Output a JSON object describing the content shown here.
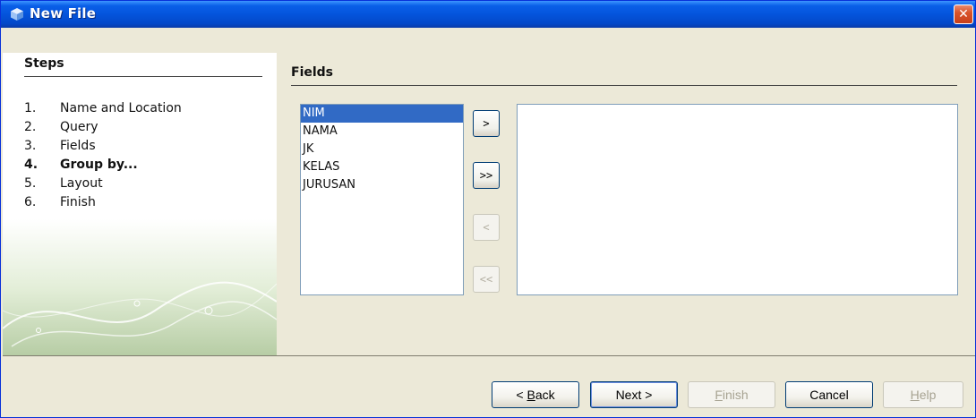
{
  "window": {
    "title": "New File",
    "close_symbol": "✕"
  },
  "steps": {
    "heading": "Steps",
    "items": [
      {
        "num": "1.",
        "label": "Name and Location",
        "current": false
      },
      {
        "num": "2.",
        "label": "Query",
        "current": false
      },
      {
        "num": "3.",
        "label": "Fields",
        "current": false
      },
      {
        "num": "4.",
        "label": "Group by...",
        "current": true
      },
      {
        "num": "5.",
        "label": "Layout",
        "current": false
      },
      {
        "num": "6.",
        "label": "Finish",
        "current": false
      }
    ]
  },
  "fields": {
    "heading": "Fields",
    "available": [
      "NIM",
      "NAMA",
      "JK",
      "KELAS",
      "JURUSAN"
    ],
    "selected_index": 0,
    "chosen": []
  },
  "arrows": {
    "add": ">",
    "add_all": ">>",
    "remove": "<",
    "remove_all": "<<"
  },
  "buttons": {
    "back_prefix": "< ",
    "back_mnemonic": "B",
    "back_rest": "ack",
    "next": "Next >",
    "finish_mnemonic": "F",
    "finish_rest": "inish",
    "cancel": "Cancel",
    "help_mnemonic": "H",
    "help_rest": "elp"
  },
  "colors": {
    "titlebar": "#0454dc",
    "selection": "#316ac5",
    "close": "#d9542b"
  }
}
